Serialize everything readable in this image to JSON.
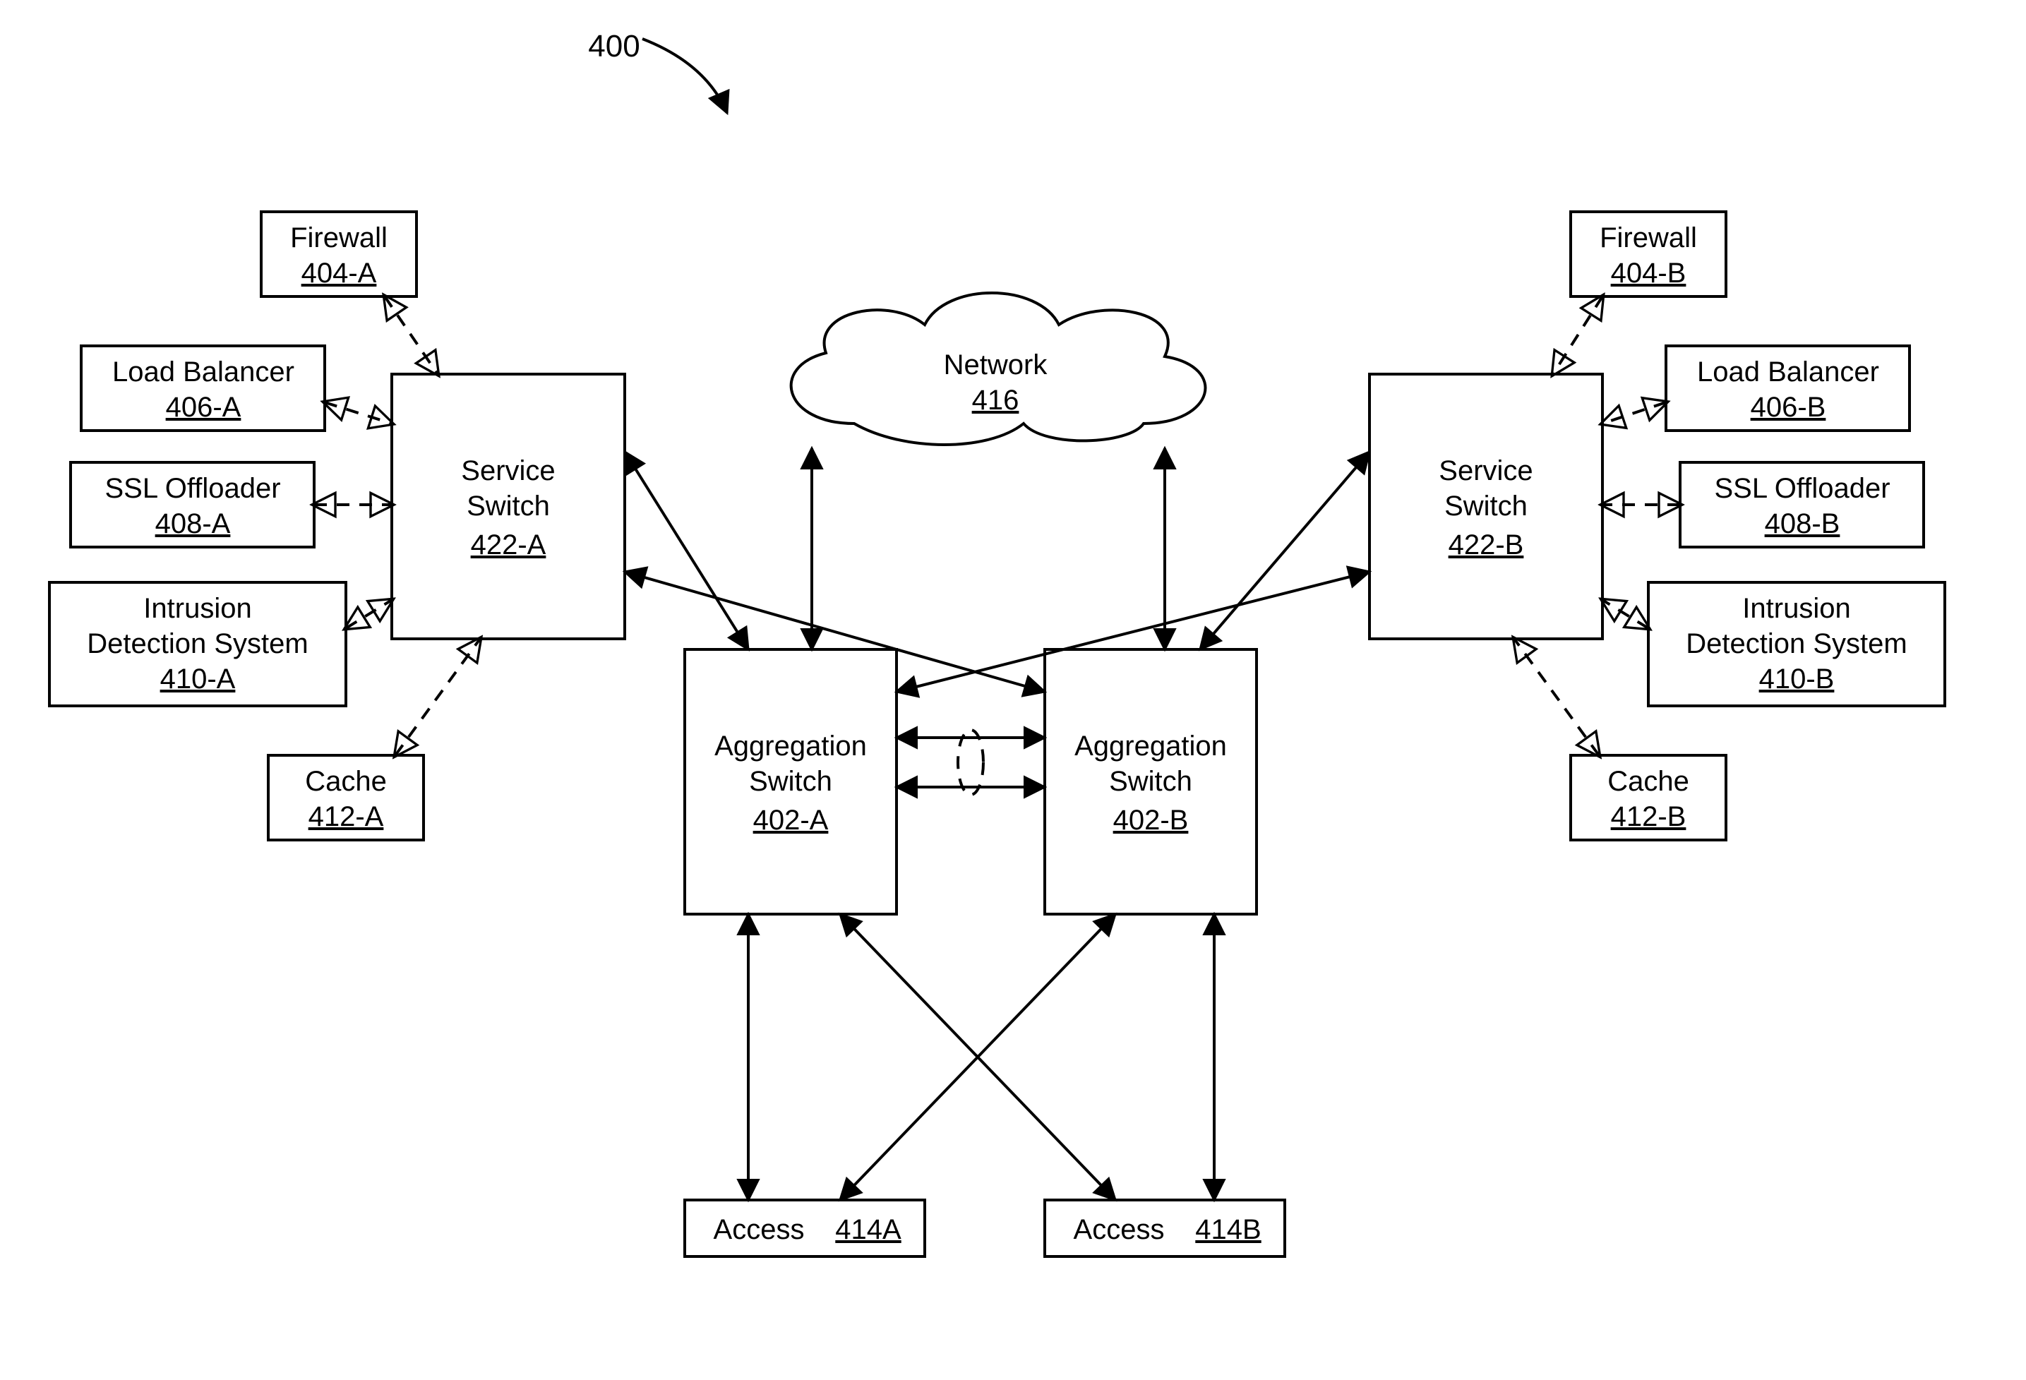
{
  "figure_ref": "400",
  "network": {
    "label": "Network",
    "ref": "416"
  },
  "svc_a": {
    "l1": "Service",
    "l2": "Switch",
    "ref": "422-A"
  },
  "svc_b": {
    "l1": "Service",
    "l2": "Switch",
    "ref": "422-B"
  },
  "agg_a": {
    "l1": "Aggregation",
    "l2": "Switch",
    "ref": "402-A"
  },
  "agg_b": {
    "l1": "Aggregation",
    "l2": "Switch",
    "ref": "402-B"
  },
  "access_a": {
    "label": "Access",
    "ref": "414A"
  },
  "access_b": {
    "label": "Access",
    "ref": "414B"
  },
  "left": {
    "firewall": {
      "label": "Firewall",
      "ref": "404-A"
    },
    "lb": {
      "label": "Load Balancer",
      "ref": "406-A"
    },
    "ssl": {
      "label": "SSL Offloader",
      "ref": "408-A"
    },
    "ids": {
      "l1": "Intrusion",
      "l2": "Detection System",
      "ref": "410-A"
    },
    "cache": {
      "label": "Cache",
      "ref": "412-A"
    }
  },
  "right": {
    "firewall": {
      "label": "Firewall",
      "ref": "404-B"
    },
    "lb": {
      "label": "Load Balancer",
      "ref": "406-B"
    },
    "ssl": {
      "label": "SSL Offloader",
      "ref": "408-B"
    },
    "ids": {
      "l1": "Intrusion",
      "l2": "Detection System",
      "ref": "410-B"
    },
    "cache": {
      "label": "Cache",
      "ref": "412-B"
    }
  }
}
